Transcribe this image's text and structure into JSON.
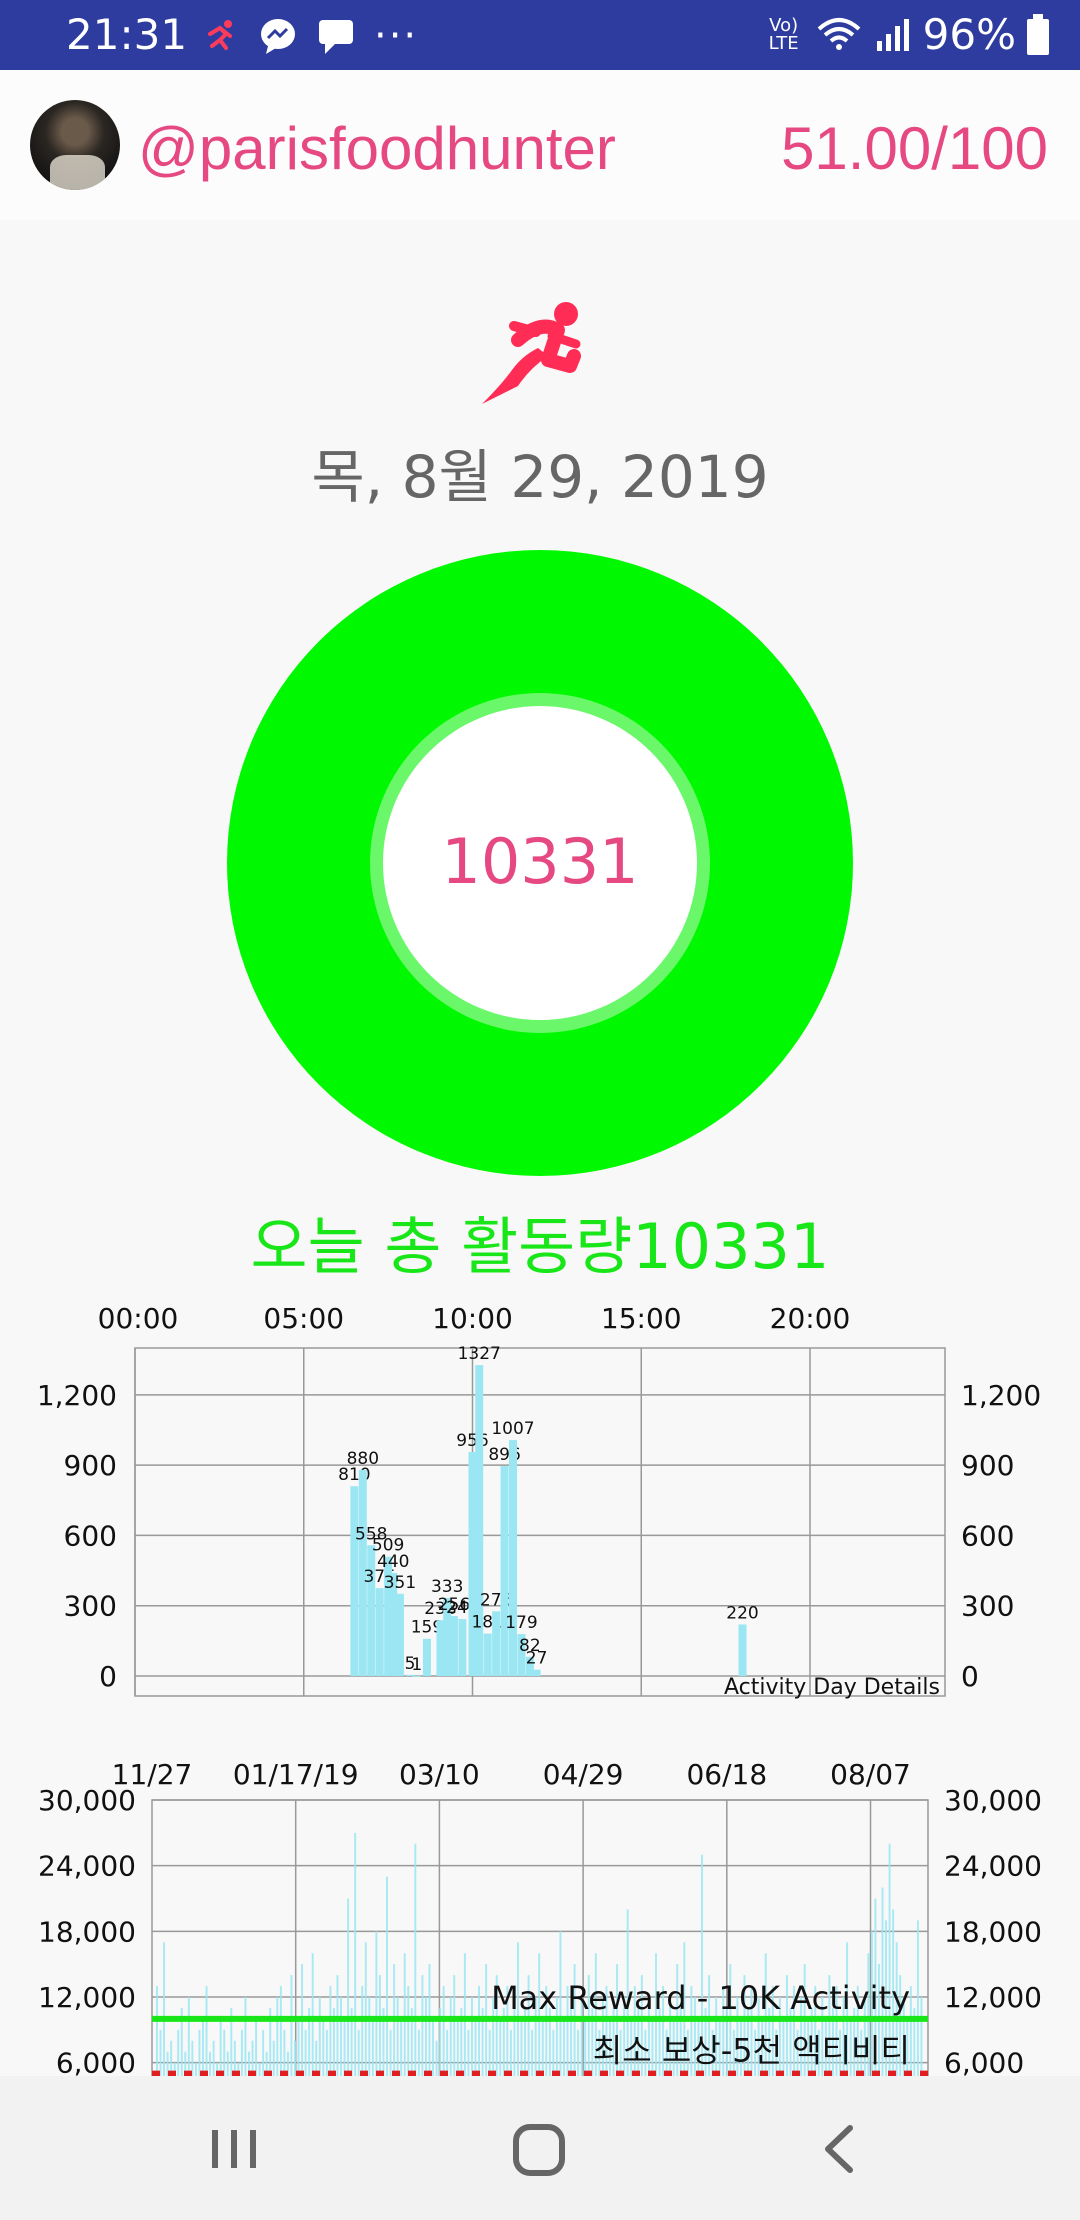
{
  "status_bar": {
    "time": "21:31",
    "battery": "96%",
    "network": "Vo) LTE",
    "more": "···",
    "icons": [
      "runner-icon",
      "messenger-icon",
      "message-icon",
      "wifi-icon",
      "signal-icon",
      "battery-icon"
    ]
  },
  "profile": {
    "username": "@parisfoodhunter",
    "score": "51.00/100"
  },
  "date": "목, 8월 29, 2019",
  "ring": {
    "value": "10331",
    "progress": 1.0,
    "colors": {
      "outer": "#00f900",
      "inner": "#6af86a",
      "center": "#ffffff"
    }
  },
  "total_label": "오늘 총 활동량10331",
  "colors": {
    "accent": "#e64981",
    "bar": "#9ae6f2",
    "max_line": "#19e619",
    "min_line": "#e02020",
    "header": "#2e3c9f"
  },
  "chart_data": [
    {
      "type": "bar",
      "xlim": [
        0,
        24
      ],
      "x_tick_labels": [
        "00:00",
        "05:00",
        "10:00",
        "15:00",
        "20:00"
      ],
      "x_ticks": [
        0,
        5,
        10,
        15,
        20
      ],
      "y_ticks": [
        0,
        300,
        600,
        900,
        1200
      ],
      "y_tick_labels": [
        "0",
        "300",
        "600",
        "900",
        "1,200"
      ],
      "ylim": [
        0,
        1400
      ],
      "grid": true,
      "note": "Activity Day Details",
      "bars": [
        {
          "h": 6.5,
          "v": 810,
          "label": "810"
        },
        {
          "h": 6.75,
          "v": 880,
          "label": "880"
        },
        {
          "h": 7.0,
          "v": 558,
          "label": "558"
        },
        {
          "h": 7.25,
          "v": 375,
          "label": "375"
        },
        {
          "h": 7.5,
          "v": 509,
          "label": "509"
        },
        {
          "h": 7.65,
          "v": 440,
          "label": "440"
        },
        {
          "h": 7.85,
          "v": 351,
          "label": "351"
        },
        {
          "h": 8.15,
          "v": 5,
          "label": "5"
        },
        {
          "h": 8.35,
          "v": 1,
          "label": "1"
        },
        {
          "h": 8.65,
          "v": 159,
          "label": "159"
        },
        {
          "h": 9.05,
          "v": 238,
          "label": "238"
        },
        {
          "h": 9.25,
          "v": 333,
          "label": "333"
        },
        {
          "h": 9.45,
          "v": 256,
          "label": "256"
        },
        {
          "h": 9.7,
          "v": 243,
          "label": "243"
        },
        {
          "h": 10.0,
          "v": 956,
          "label": "956"
        },
        {
          "h": 10.2,
          "v": 1327,
          "label": "1327"
        },
        {
          "h": 10.45,
          "v": 181,
          "label": "181"
        },
        {
          "h": 10.7,
          "v": 276,
          "label": "276"
        },
        {
          "h": 10.95,
          "v": 896,
          "label": "896"
        },
        {
          "h": 11.2,
          "v": 1007,
          "label": "1007"
        },
        {
          "h": 11.45,
          "v": 179,
          "label": "179"
        },
        {
          "h": 11.7,
          "v": 82,
          "label": "82"
        },
        {
          "h": 11.9,
          "v": 27,
          "label": "27"
        },
        {
          "h": 18.0,
          "v": 220,
          "label": "220"
        }
      ]
    },
    {
      "type": "bar",
      "x_tick_labels": [
        "11/27",
        "01/17/19",
        "03/10",
        "04/29",
        "06/18",
        "08/07"
      ],
      "y_ticks": [
        6000,
        12000,
        18000,
        24000,
        30000
      ],
      "y_tick_labels": [
        "6,000",
        "12,000",
        "18,000",
        "24,000",
        "30,000"
      ],
      "ylim": [
        4600,
        30000
      ],
      "grid": true,
      "max_reward": 10000,
      "max_reward_label": "Max Reward - 10K Activity",
      "min_reward": 5000,
      "min_reward_label": "최소 보상-5천 액티비티",
      "values": [
        13000,
        9000,
        17000,
        7000,
        8000,
        6000,
        9000,
        11000,
        7000,
        12000,
        8000,
        6000,
        9000,
        10000,
        13000,
        7000,
        8000,
        6000,
        10000,
        9000,
        7000,
        11000,
        8000,
        6000,
        9000,
        12000,
        7000,
        8000,
        10000,
        6000,
        9000,
        7000,
        11000,
        8000,
        12000,
        13000,
        9000,
        7000,
        14000,
        8000,
        10000,
        15000,
        9000,
        11000,
        16000,
        8000,
        12000,
        10000,
        9000,
        13000,
        11000,
        14000,
        12000,
        10000,
        21000,
        11000,
        27000,
        9000,
        13000,
        17000,
        12000,
        10000,
        18000,
        14000,
        11000,
        23000,
        9000,
        15000,
        12000,
        10000,
        16000,
        13000,
        11000,
        26000,
        9000,
        14000,
        12000,
        15000,
        10000,
        8000,
        11000,
        13000,
        9000,
        12000,
        14000,
        10000,
        11000,
        16000,
        9000,
        12000,
        10000,
        13000,
        11000,
        15000,
        9000,
        12000,
        14000,
        10000,
        11000,
        13000,
        9000,
        12000,
        17000,
        10000,
        11000,
        14000,
        9000,
        12000,
        16000,
        10000,
        13000,
        11000,
        9000,
        12000,
        18000,
        10000,
        13000,
        11000,
        15000,
        9000,
        12000,
        10000,
        14000,
        11000,
        16000,
        9000,
        12000,
        13000,
        10000,
        11000,
        15000,
        9000,
        12000,
        20000,
        10000,
        13000,
        11000,
        14000,
        9000,
        12000,
        10000,
        16000,
        11000,
        13000,
        9000,
        12000,
        10000,
        15000,
        11000,
        17000,
        9000,
        13000,
        12000,
        10000,
        25000,
        11000,
        14000,
        9000,
        12000,
        10000,
        13000,
        11000,
        15000,
        9000,
        12000,
        10000,
        14000,
        11000,
        13000,
        9000,
        12000,
        10000,
        16000,
        11000,
        13000,
        9000,
        12000,
        10000,
        14000,
        11000,
        13000,
        9000,
        12000,
        15000,
        10000,
        11000,
        13000,
        9000,
        12000,
        10000,
        14000,
        11000,
        13000,
        9000,
        12000,
        17000,
        10000,
        11000,
        13000,
        9000,
        12000,
        16000,
        18000,
        21000,
        15000,
        22000,
        19000,
        26000,
        20000,
        17000,
        14000,
        12000,
        10000,
        13000,
        11000,
        19000,
        12000
      ]
    }
  ],
  "nav": {
    "recents": "recents-button",
    "home": "home-button",
    "back": "back-button"
  }
}
